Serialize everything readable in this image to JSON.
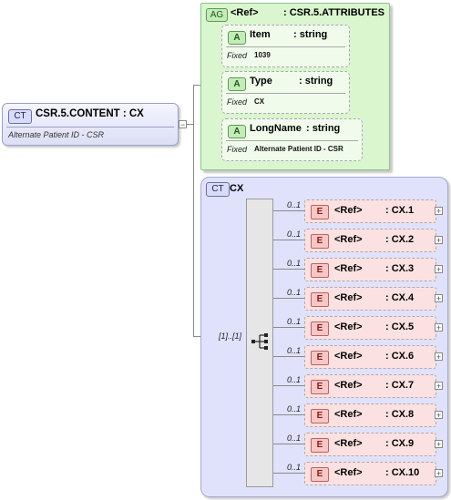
{
  "root": {
    "badge": "CT",
    "title": "CSR.5.CONTENT : CX",
    "documentation": "Alternate Patient ID - CSR",
    "collapse_symbol": "−"
  },
  "attribute_group": {
    "badge": "AG",
    "ref_label": "<Ref>",
    "name": ": CSR.5.ATTRIBUTES",
    "attributes": [
      {
        "badge": "A",
        "name": "Item",
        "type": ": string",
        "fixed_label": "Fixed",
        "fixed_value": "1039"
      },
      {
        "badge": "A",
        "name": "Type",
        "type": ": string",
        "fixed_label": "Fixed",
        "fixed_value": "CX"
      },
      {
        "badge": "A",
        "name": "LongName",
        "type": ": string",
        "fixed_label": "Fixed",
        "fixed_value": "Alternate Patient ID - CSR"
      }
    ]
  },
  "complex_type": {
    "badge": "CT",
    "name": "CX",
    "sequence_occurrence": "[1]..[1]",
    "elements": [
      {
        "occurrence": "0..1",
        "badge": "E",
        "ref": "<Ref>",
        "name": ": CX.1",
        "expand": "+"
      },
      {
        "occurrence": "0..1",
        "badge": "E",
        "ref": "<Ref>",
        "name": ": CX.2",
        "expand": "+"
      },
      {
        "occurrence": "0..1",
        "badge": "E",
        "ref": "<Ref>",
        "name": ": CX.3",
        "expand": "+"
      },
      {
        "occurrence": "0..1",
        "badge": "E",
        "ref": "<Ref>",
        "name": ": CX.4",
        "expand": "+"
      },
      {
        "occurrence": "0..1",
        "badge": "E",
        "ref": "<Ref>",
        "name": ": CX.5",
        "expand": "+"
      },
      {
        "occurrence": "0..1",
        "badge": "E",
        "ref": "<Ref>",
        "name": ": CX.6",
        "expand": "+"
      },
      {
        "occurrence": "0..1",
        "badge": "E",
        "ref": "<Ref>",
        "name": ": CX.7",
        "expand": "+"
      },
      {
        "occurrence": "0..1",
        "badge": "E",
        "ref": "<Ref>",
        "name": ": CX.8",
        "expand": "+"
      },
      {
        "occurrence": "0..1",
        "badge": "E",
        "ref": "<Ref>",
        "name": ": CX.9",
        "expand": "+"
      },
      {
        "occurrence": "0..1",
        "badge": "E",
        "ref": "<Ref>",
        "name": ": CX.10",
        "expand": "+"
      }
    ]
  }
}
